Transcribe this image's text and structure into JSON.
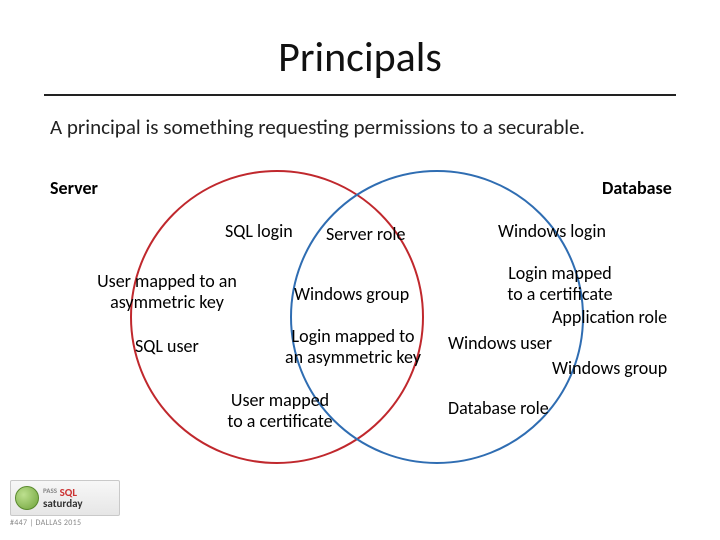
{
  "title": "Principals",
  "subtitle": "A principal is something requesting permissions to a securable.",
  "left_heading": "Server",
  "right_heading": "Database",
  "labels": {
    "sql_login": "SQL login",
    "server_role": "Server role",
    "windows_login": "Windows login",
    "user_asym_key_l1": "User mapped to an",
    "user_asym_key_l2": "asymmetric key",
    "windows_group_center": "Windows group",
    "login_cert_l1": "Login mapped",
    "login_cert_l2": "to a certificate",
    "sql_user": "SQL user",
    "login_asym_l1": "Login mapped to",
    "login_asym_l2": "an asymmetric key",
    "windows_user": "Windows user",
    "application_role": "Application role",
    "user_cert_l1": "User mapped",
    "user_cert_l2": "to a certificate",
    "database_role": "Database role",
    "windows_group_right": "Windows group"
  },
  "footer": {
    "brand_top": "SQL",
    "brand_bottom": "saturday",
    "caption": "#447 | DALLAS 2015"
  },
  "chart_data": {
    "type": "venn",
    "title": "Principals",
    "sets": [
      {
        "name": "Server",
        "color": "#c0282d"
      },
      {
        "name": "Database",
        "color": "#2f6db2"
      }
    ],
    "regions": {
      "Server_only": [
        "SQL login",
        "Server role",
        "Windows login",
        "Login mapped to a certificate",
        "Login mapped to an asymmetric key",
        "Windows group"
      ],
      "Database_only": [
        "User mapped to an asymmetric key",
        "SQL user",
        "Windows user",
        "Application role",
        "Windows group",
        "User mapped to a certificate",
        "Database role"
      ],
      "Intersection": []
    }
  }
}
